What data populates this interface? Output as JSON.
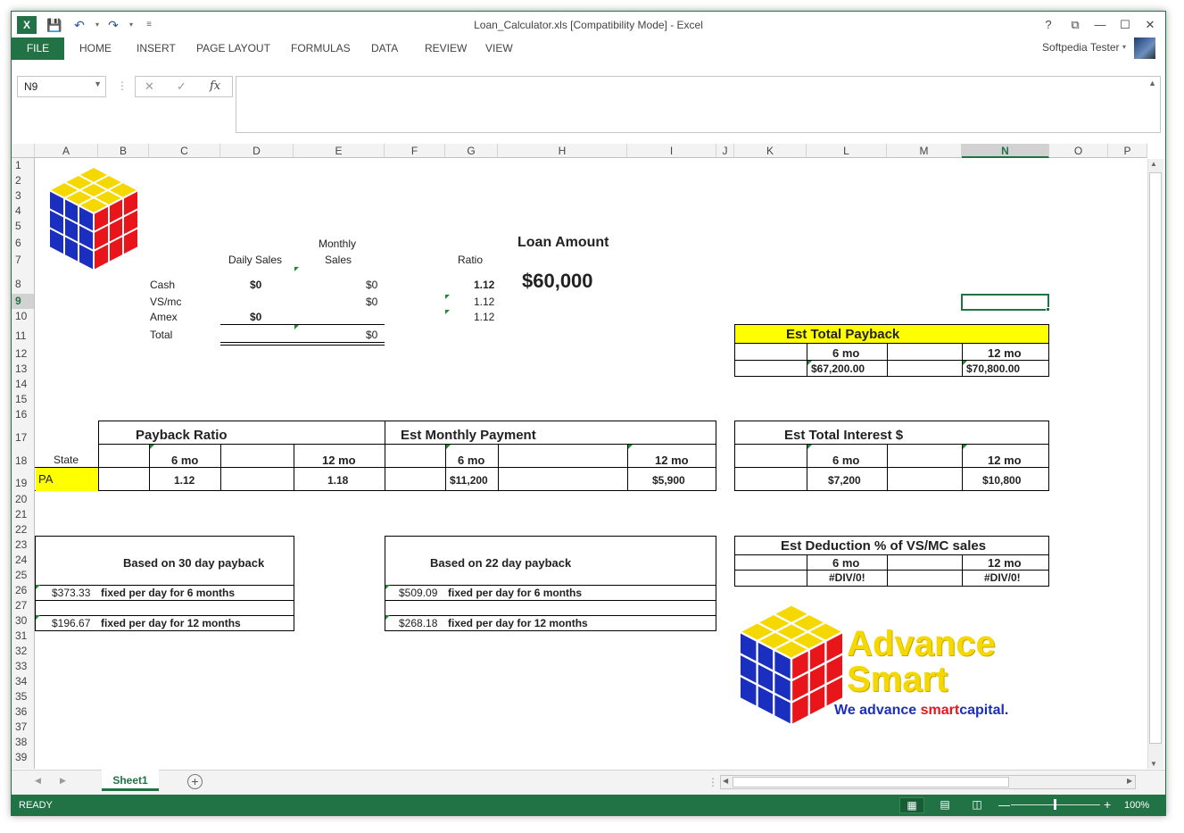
{
  "window": {
    "title": "Loan_Calculator.xls  [Compatibility Mode] - Excel",
    "help": "?",
    "restore": "⧉",
    "minimize": "—",
    "maximize": "☐",
    "close": "✕",
    "user": "Softpedia Tester"
  },
  "ribbon": {
    "tabs": [
      "FILE",
      "HOME",
      "INSERT",
      "PAGE LAYOUT",
      "FORMULAS",
      "DATA",
      "REVIEW",
      "VIEW"
    ]
  },
  "formula_bar": {
    "name_box": "N9",
    "value": ""
  },
  "grid": {
    "columns": [
      "A",
      "B",
      "C",
      "D",
      "E",
      "F",
      "G",
      "H",
      "I",
      "J",
      "K",
      "L",
      "M",
      "N",
      "O",
      "P"
    ],
    "rows": [
      "1",
      "2",
      "3",
      "4",
      "5",
      "6",
      "7",
      "8",
      "9",
      "10",
      "11",
      "12",
      "13",
      "14",
      "15",
      "16",
      "17",
      "18",
      "19",
      "20",
      "21",
      "22",
      "23",
      "24",
      "25",
      "26",
      "27",
      "30",
      "31",
      "32",
      "33",
      "34",
      "35",
      "36",
      "37",
      "38",
      "39"
    ],
    "selected_column": "N",
    "selected_row": "9"
  },
  "sales": {
    "daily_header": "Daily Sales",
    "monthly_header_1": "Monthly",
    "monthly_header_2": "Sales",
    "ratio_header": "Ratio",
    "rows": [
      {
        "label": "Cash",
        "daily": "$0",
        "monthly": "$0",
        "ratio": "1.12"
      },
      {
        "label": "VS/mc",
        "daily": "",
        "monthly": "$0",
        "ratio": "1.12"
      },
      {
        "label": "Amex",
        "daily": "$0",
        "monthly": "",
        "ratio": "1.12"
      }
    ],
    "total_label": "Total",
    "total_value": "$0"
  },
  "loan": {
    "label": "Loan Amount",
    "amount": "$60,000"
  },
  "est_total_payback": {
    "title": "Est Total Payback",
    "col1": "6 mo",
    "col2": "12 mo",
    "val1": "$67,200.00",
    "val2": "$70,800.00"
  },
  "payback_ratio": {
    "title": "Payback Ratio",
    "state_label": "State",
    "col1": "6 mo",
    "col2": "12 mo",
    "state": "PA",
    "val1": "1.12",
    "val2": "1.18"
  },
  "est_monthly_payment": {
    "title": "Est Monthly Payment",
    "col1": "6 mo",
    "col2": "12 mo",
    "val1": "$11,200",
    "val2": "$5,900"
  },
  "est_total_interest": {
    "title": "Est Total Interest $",
    "col1": "6 mo",
    "col2": "12 mo",
    "val1": "$7,200",
    "val2": "$10,800"
  },
  "payback30": {
    "title": "Based on 30 day payback",
    "amt6": "$373.33",
    "txt6": "fixed per day for 6 months",
    "amt12": "$196.67",
    "txt12": "fixed per day for 12 months"
  },
  "payback22": {
    "title": "Based on 22 day payback",
    "amt6": "$509.09",
    "txt6": "fixed per day for 6 months",
    "amt12": "$268.18",
    "txt12": "fixed per day for 12 months"
  },
  "est_deduction": {
    "title": "Est Deduction % of VS/MC sales",
    "col1": "6 mo",
    "col2": "12 mo",
    "val1": "#DIV/0!",
    "val2": "#DIV/0!"
  },
  "logo": {
    "line1": "Advance",
    "line2": "Smart",
    "tagline_a": "We advance ",
    "tagline_b": "smart",
    "tagline_c": "capital."
  },
  "sheets": {
    "active": "Sheet1"
  },
  "status": {
    "mode": "READY",
    "zoom": "100%"
  },
  "colors": {
    "excel_green": "#217346",
    "highlight_yellow": "#ffff00",
    "logo_yellow": "#f5d800",
    "logo_blue": "#1a2fbf",
    "logo_red": "#e8161b"
  }
}
